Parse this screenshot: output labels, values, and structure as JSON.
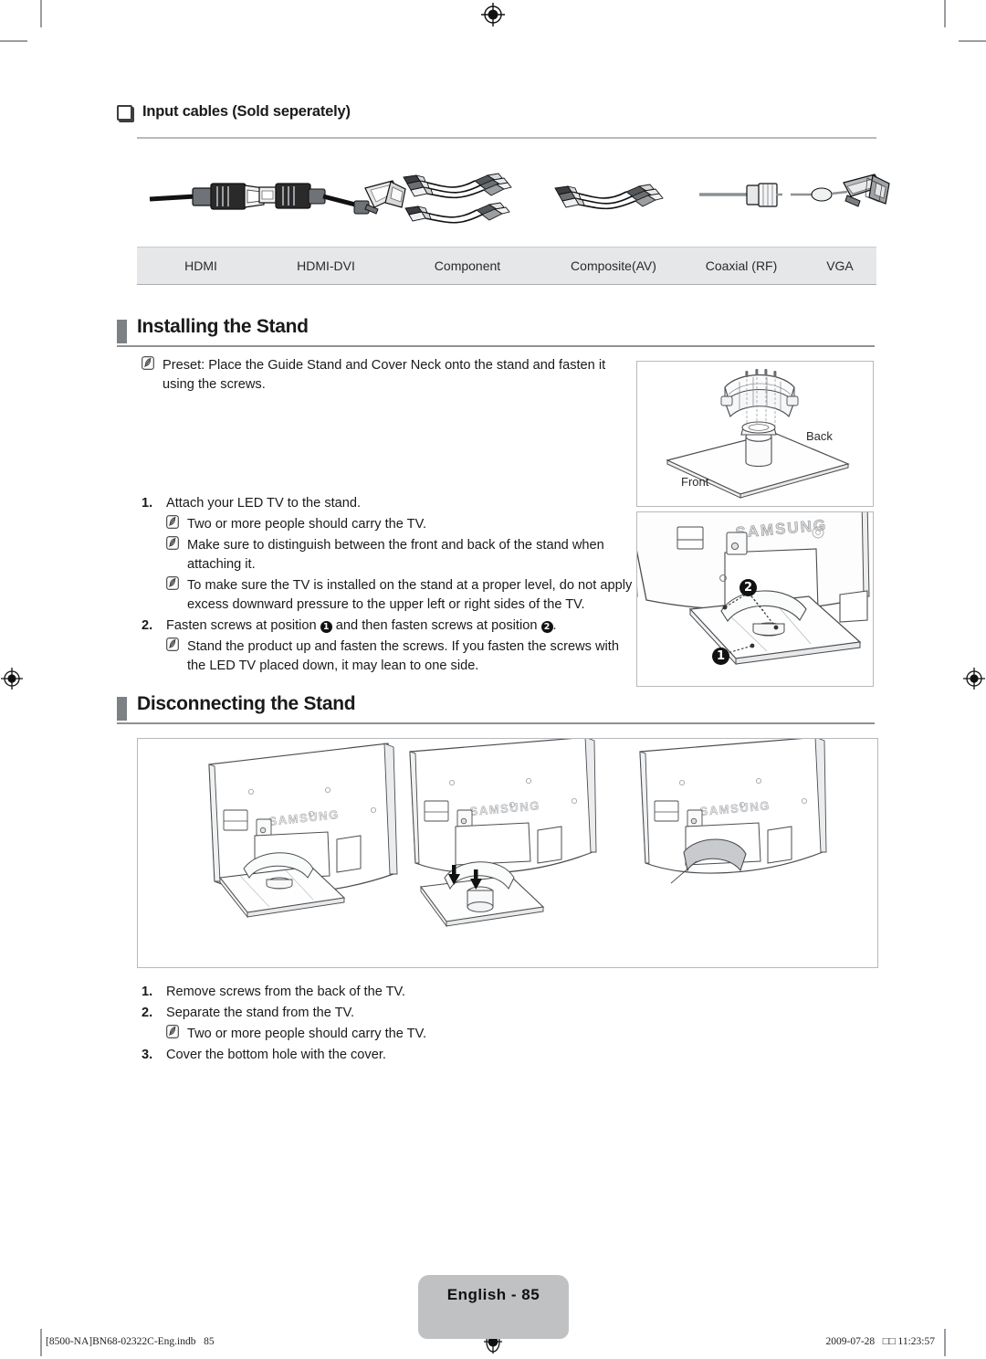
{
  "document": {
    "page_label": "English - 85",
    "footer_left": "[8500-NA]BN68-02322C-Eng.indb   85",
    "footer_right": "2009-07-28   □□ 11:23:57"
  },
  "input_cables": {
    "heading": "Input cables (Sold seperately)",
    "items": [
      {
        "label": "HDMI",
        "icon": "hdmi-cable-icon"
      },
      {
        "label": "HDMI-DVI",
        "icon": "hdmi-dvi-cable-icon"
      },
      {
        "label": "Component",
        "icon": "component-cable-icon"
      },
      {
        "label": "Composite(AV)",
        "icon": "composite-av-cable-icon"
      },
      {
        "label": "Coaxial (RF)",
        "icon": "coaxial-rf-cable-icon"
      },
      {
        "label": "VGA",
        "icon": "vga-cable-icon"
      }
    ]
  },
  "installing": {
    "title": "Installing the Stand",
    "preset_note": "Preset: Place the Guide Stand and Cover Neck onto the stand and fasten it using the screws.",
    "steps": [
      {
        "num": "1.",
        "text": "Attach your LED TV to the stand.",
        "notes": [
          "Two or more people should carry the TV.",
          "Make sure to distinguish between the front and back of the stand when attaching it.",
          "To make sure the TV is installed on the stand at a proper level, do not apply excess downward pressure to the upper left or right sides of the TV."
        ]
      },
      {
        "num": "2.",
        "text_before": "Fasten screws at position",
        "badge_1": "1",
        "text_middle": "and then fasten screws at position",
        "badge_2": "2",
        "text_after": ".",
        "notes": [
          "Stand the product up and fasten the screws. If you fasten the screws with the LED TV placed down, it may lean to one side."
        ]
      }
    ],
    "figure_stand": {
      "name": "stand-assembly-figure",
      "label_back": "Back",
      "label_front": "Front"
    },
    "figure_tv": {
      "name": "tv-stand-screws-figure",
      "badge_1": "1",
      "badge_2": "2",
      "brand": "SAMSUNG"
    }
  },
  "disconnecting": {
    "title": "Disconnecting the Stand",
    "figures": [
      {
        "name": "tv-on-stand-figure",
        "brand": "SAMSUNG"
      },
      {
        "name": "tv-stand-separating-figure",
        "brand": "SAMSUNG"
      },
      {
        "name": "tv-cover-bottom-hole-figure",
        "brand": "SAMSUNG"
      }
    ],
    "steps": [
      {
        "num": "1.",
        "text": "Remove screws from the back of the TV.",
        "notes": []
      },
      {
        "num": "2.",
        "text": "Separate the stand from the TV.",
        "notes": [
          "Two or more people should carry the TV."
        ]
      },
      {
        "num": "3.",
        "text": "Cover the bottom hole with the cover.",
        "notes": []
      }
    ]
  },
  "colors": {
    "header_tab": "#7d8084",
    "header_rule": "#8e9195",
    "label_band": "#e6e7e8",
    "page_tag": "#c0c1c3"
  }
}
